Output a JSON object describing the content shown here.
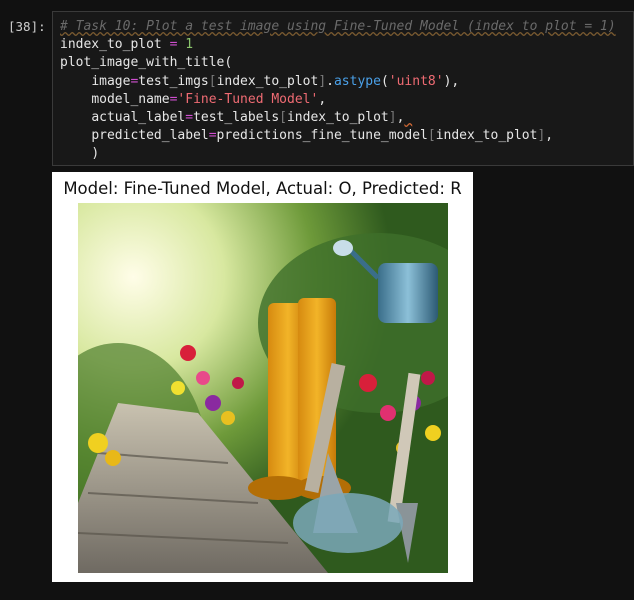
{
  "cell": {
    "prompt": "[38]:",
    "code_comment": "# Task 10: Plot a test image using Fine-Tuned Model (index to plot = 1)",
    "line_index_var": "index_to_plot",
    "line_index_op": " = ",
    "line_index_val": "1",
    "call_fn": "plot_image_with_title(",
    "arg_image_kw": "image",
    "arg_image_var": "test_imgs",
    "arg_image_idx": "index_to_plot",
    "arg_image_method": "astype",
    "arg_image_str": "'uint8'",
    "arg_model_kw": "model_name",
    "arg_model_str": "'Fine-Tuned Model'",
    "arg_actual_kw": "actual_label",
    "arg_actual_var": "test_labels",
    "arg_actual_idx": "index_to_plot",
    "arg_pred_kw": "predicted_label",
    "arg_pred_var": "predictions_fine_tune_model",
    "arg_pred_idx": "index_to_plot",
    "close_paren": ")"
  },
  "output": {
    "title": "Model: Fine-Tuned Model, Actual: O, Predicted: R",
    "image_description_icon": "garden-photo-image"
  }
}
